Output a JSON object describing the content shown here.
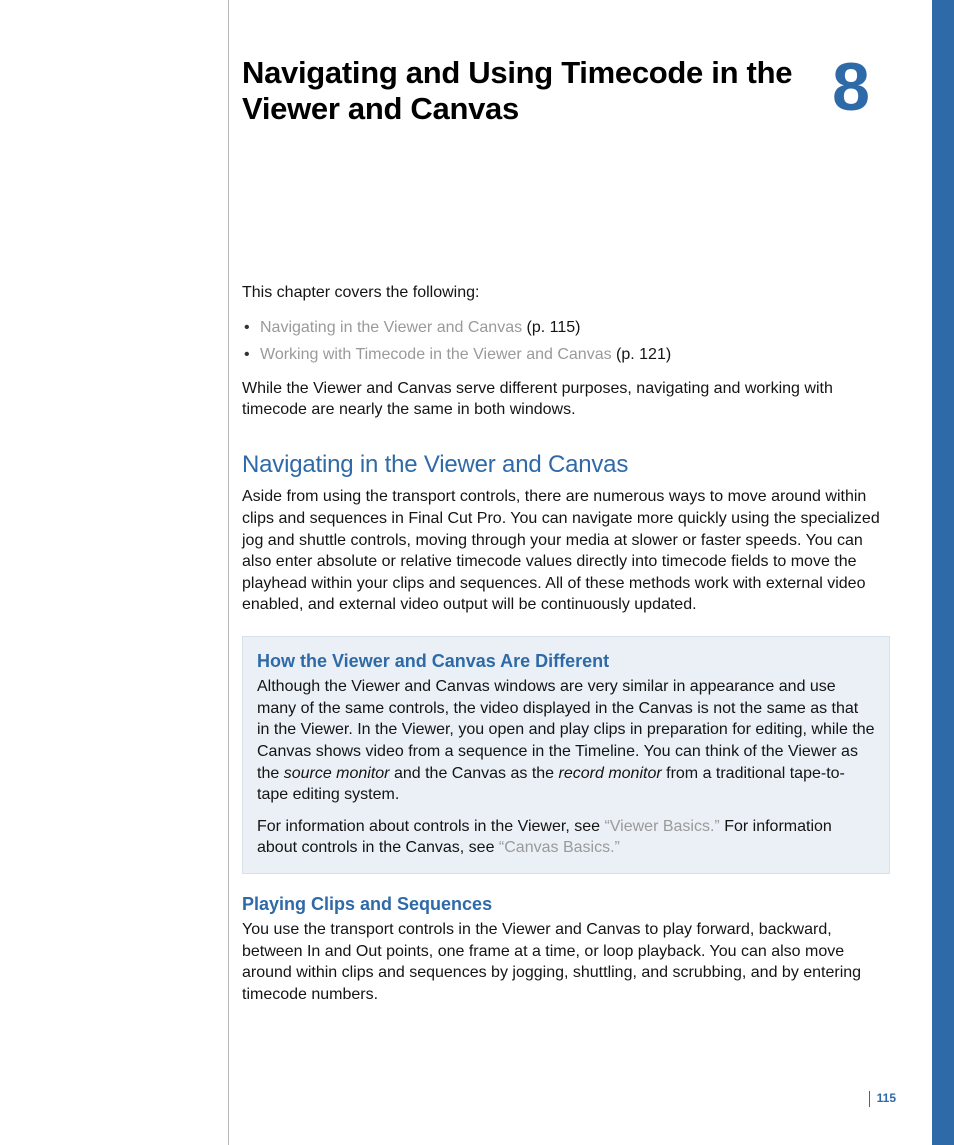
{
  "chapter": {
    "title": "Navigating and Using Timecode in the Viewer and Canvas",
    "number": "8"
  },
  "intro": {
    "covers_label": "This chapter covers the following:",
    "items": [
      {
        "link": "Navigating in the Viewer and Canvas",
        "page_ref": " (p. 115)"
      },
      {
        "link": "Working with Timecode in the Viewer and Canvas",
        "page_ref": " (p. 121)"
      }
    ],
    "paragraph": "While the Viewer and Canvas serve different purposes, navigating and working with timecode are nearly the same in both windows."
  },
  "section_nav": {
    "heading": "Navigating in the Viewer and Canvas",
    "paragraph": "Aside from using the transport controls, there are numerous ways to move around within clips and sequences in Final Cut Pro. You can navigate more quickly using the specialized jog and shuttle controls, moving through your media at slower or faster speeds. You can also enter absolute or relative timecode values directly into timecode fields to move the playhead within your clips and sequences. All of these methods work with external video enabled, and external video output will be continuously updated."
  },
  "callout": {
    "heading": "How the Viewer and Canvas Are Different",
    "p1_a": "Although the Viewer and Canvas windows are very similar in appearance and use many of the same controls, the video displayed in the Canvas is not the same as that in the Viewer. In the Viewer, you open and play clips in preparation for editing, while the Canvas shows video from a sequence in the Timeline. You can think of the Viewer as the ",
    "p1_i1": "source monitor",
    "p1_b": " and the Canvas as the ",
    "p1_i2": "record monitor",
    "p1_c": " from a traditional tape-to-tape editing system.",
    "p2_a": "For information about controls in the Viewer, see ",
    "p2_link1": "“Viewer Basics.”",
    "p2_b": " For information about controls in the Canvas, see ",
    "p2_link2": "“Canvas Basics.”"
  },
  "section_play": {
    "heading": "Playing Clips and Sequences",
    "paragraph": "You use the transport controls in the Viewer and Canvas to play forward, backward, between In and Out points, one frame at a time, or loop playback. You can also move around within clips and sequences by jogging, shuttling, and scrubbing, and by entering timecode numbers."
  },
  "page_number": "115"
}
